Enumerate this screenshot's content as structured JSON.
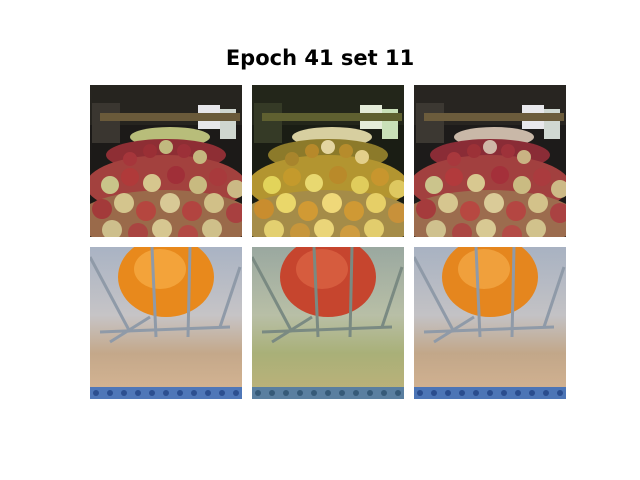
{
  "figure": {
    "title": "Epoch 41 set 11"
  },
  "rows": [
    {
      "scene": "apples-market",
      "panels": [
        {
          "role": "input",
          "tint": "natural"
        },
        {
          "role": "output",
          "tint": "yellow-green"
        },
        {
          "role": "target",
          "tint": "natural"
        }
      ]
    },
    {
      "scene": "orange-in-wire-basket",
      "panels": [
        {
          "role": "input",
          "tint": "natural"
        },
        {
          "role": "output",
          "tint": "red-green"
        },
        {
          "role": "target",
          "tint": "natural"
        }
      ]
    }
  ]
}
